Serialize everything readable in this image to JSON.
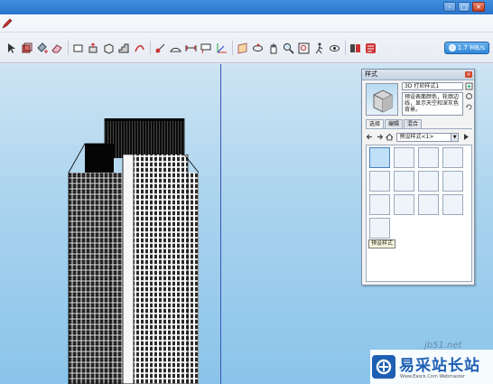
{
  "network": {
    "speed": "1.7 MB/s"
  },
  "styles_panel": {
    "title": "样式",
    "style_name": "3D 打印样式1",
    "style_description": "预设表面颜色，轮廓边线，显示天空和深灰色背景。",
    "tabs": [
      {
        "label": "选择"
      },
      {
        "label": "编辑"
      },
      {
        "label": "混合"
      }
    ],
    "collection": "预设样式<1>",
    "tooltip": "预设样式"
  },
  "watermark": {
    "url": "jb51.net",
    "brand": "易采站长站",
    "domain": "Www.Easck.Com Webmaster"
  },
  "colors": {
    "sky_top": "#cde4f3",
    "sky_bottom": "#8ac4ea",
    "axis_blue": "#3a55b8",
    "titlebar": "#2b74cc"
  }
}
